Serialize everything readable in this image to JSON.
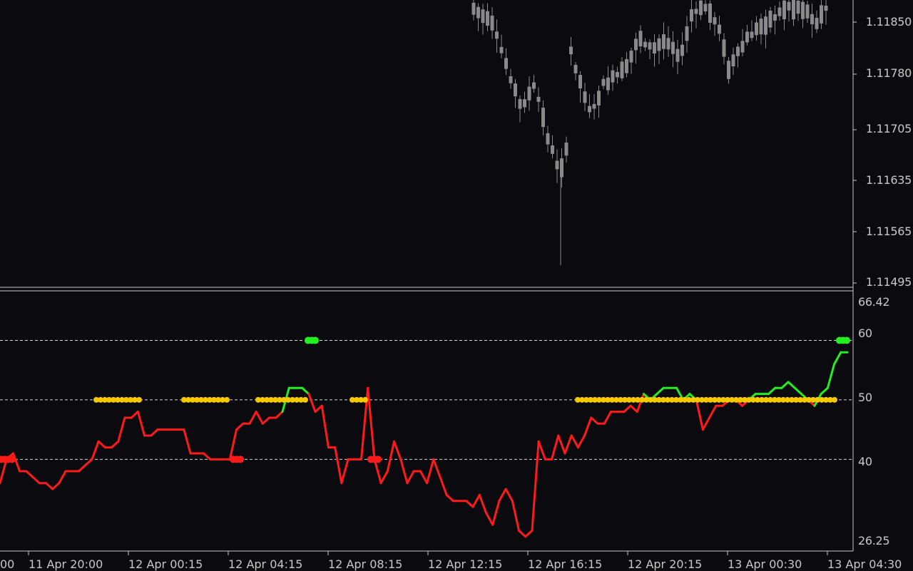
{
  "colors": {
    "background": "#0b0a0f",
    "candle": "#8a8a8a",
    "axis": "#c8c8c8",
    "osc_bear": "#ff1a1a",
    "osc_bull": "#22ee22",
    "signal_mid": "#f5c800",
    "level_line": "#d8d8d8"
  },
  "price_pane": {
    "axis_labels": [
      "1.11850",
      "1.11780",
      "1.11705",
      "1.11635",
      "1.11565",
      "1.11495"
    ]
  },
  "indicator_pane": {
    "axis_labels": [
      "66.42",
      "60",
      "50",
      "40",
      "26.25"
    ],
    "levels": [
      60,
      50,
      40
    ]
  },
  "time_axis": {
    "labels": [
      "00",
      "11 Apr 20:00",
      "12 Apr 00:15",
      "12 Apr 04:15",
      "12 Apr 08:15",
      "12 Apr 12:15",
      "12 Apr 16:15",
      "12 Apr 20:15",
      "13 Apr 00:30",
      "13 Apr 04:30"
    ]
  },
  "chart_data": {
    "type": "line",
    "indicator_range": [
      26.25,
      66.42
    ],
    "oscillator": [
      36,
      40,
      41,
      38,
      38,
      37,
      36,
      36,
      35,
      36,
      38,
      38,
      38,
      39,
      40,
      43,
      42,
      42,
      43,
      47,
      47,
      48,
      44,
      44,
      45,
      45,
      45,
      45,
      45,
      41,
      41,
      41,
      40,
      40,
      40,
      40,
      45,
      46,
      46,
      48,
      46,
      47,
      47,
      48,
      52,
      52,
      52,
      51,
      48,
      49,
      42,
      42,
      36,
      40,
      40,
      40,
      52,
      40,
      36,
      38,
      43,
      40,
      36,
      38,
      38,
      36,
      40,
      37,
      34,
      33,
      33,
      33,
      32,
      34,
      31,
      29,
      33,
      35,
      33,
      28,
      27,
      28,
      43,
      40,
      40,
      44,
      41,
      44,
      42,
      44,
      47,
      46,
      46,
      48,
      48,
      48,
      49,
      48,
      51,
      50,
      51,
      52,
      52,
      52,
      50,
      51,
      50,
      45,
      47,
      49,
      49,
      50,
      50,
      49,
      50,
      51,
      51,
      51,
      52,
      52,
      53,
      52,
      51,
      50,
      49,
      51,
      52,
      56,
      58,
      58
    ]
  }
}
